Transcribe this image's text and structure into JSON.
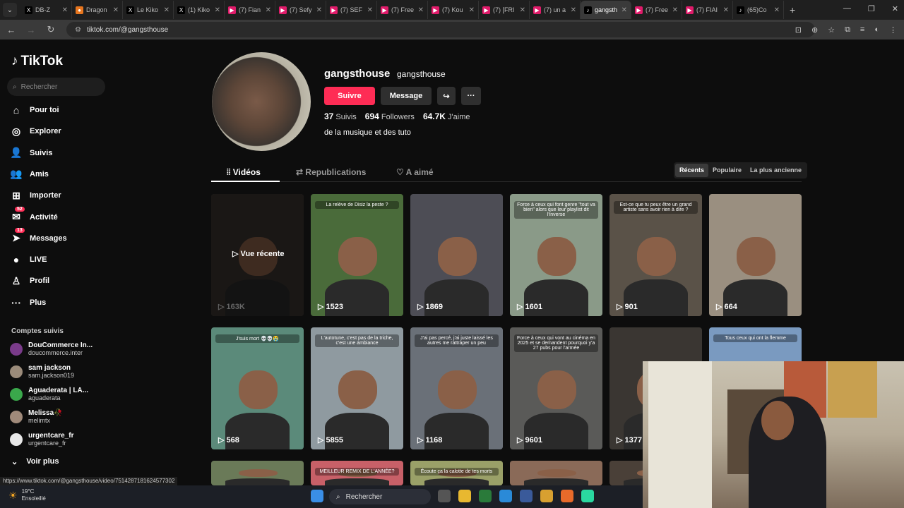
{
  "tabs": [
    {
      "label": "DB-Z",
      "color": "#000",
      "glyph": "X"
    },
    {
      "label": "Dragon",
      "color": "#e8761e",
      "glyph": "●"
    },
    {
      "label": "Le Kiko",
      "color": "#000",
      "glyph": "X"
    },
    {
      "label": "(1) Kiko",
      "color": "#000",
      "glyph": "X"
    },
    {
      "label": "(7) Fian",
      "color": "#e01b6a",
      "glyph": "▶"
    },
    {
      "label": "(7) Sefy",
      "color": "#e01b6a",
      "glyph": "▶"
    },
    {
      "label": "(7) SEF",
      "color": "#e01b6a",
      "glyph": "▶"
    },
    {
      "label": "(7) Free",
      "color": "#e01b6a",
      "glyph": "▶"
    },
    {
      "label": "(7) Kou",
      "color": "#e01b6a",
      "glyph": "▶"
    },
    {
      "label": "(7) [FRI",
      "color": "#e01b6a",
      "glyph": "▶"
    },
    {
      "label": "(7) un a",
      "color": "#e01b6a",
      "glyph": "▶"
    },
    {
      "label": "gangsth",
      "color": "#000",
      "glyph": "♪",
      "active": true
    },
    {
      "label": "(7) Free",
      "color": "#e01b6a",
      "glyph": "▶"
    },
    {
      "label": "(7) FIAI",
      "color": "#e01b6a",
      "glyph": "▶"
    },
    {
      "label": "(65)Co",
      "color": "#000",
      "glyph": "♪"
    }
  ],
  "address": {
    "url": "tiktok.com/@gangsthouse"
  },
  "sidebar": {
    "logo": "TikTok",
    "search_placeholder": "Rechercher",
    "items": [
      {
        "label": "Pour toi",
        "icon": "⌂"
      },
      {
        "label": "Explorer",
        "icon": "◎"
      },
      {
        "label": "Suivis",
        "icon": "👤"
      },
      {
        "label": "Amis",
        "icon": "👥"
      },
      {
        "label": "Importer",
        "icon": "⊞"
      },
      {
        "label": "Activité",
        "icon": "✉",
        "badge": "52"
      },
      {
        "label": "Messages",
        "icon": "➤",
        "badge": "13"
      },
      {
        "label": "LIVE",
        "icon": "●"
      },
      {
        "label": "Profil",
        "icon": "♙"
      },
      {
        "label": "Plus",
        "icon": "···"
      }
    ],
    "followed_title": "Comptes suivis",
    "followed": [
      {
        "name": "DouCommerce In...",
        "handle": "doucommerce.inter",
        "color": "#7a3b8a"
      },
      {
        "name": "sam jackson",
        "handle": "sam.jackson019",
        "color": "#9b8b7a"
      },
      {
        "name": "Aguaderata | LA...",
        "handle": "aguaderata",
        "color": "#3aa84b"
      },
      {
        "name": "Melissa🥀",
        "handle": "melimtx",
        "color": "#a08a7a"
      },
      {
        "name": "urgentcare_fr",
        "handle": "urgentcare_fr",
        "color": "#e8e8e8"
      }
    ],
    "more_label": "Voir plus"
  },
  "profile": {
    "username": "gangsthouse",
    "display": "gangsthouse",
    "follow_label": "Suivre",
    "message_label": "Message",
    "following_count": "37",
    "following_label": "Suivis",
    "followers_count": "694",
    "followers_label": "Followers",
    "likes_count": "64.7K",
    "likes_label": "J'aime",
    "bio": "de la musique et des tuto"
  },
  "tabs_profile": {
    "videos": "Vidéos",
    "reposts": "Republications",
    "liked": "A aimé"
  },
  "sort": {
    "recent": "Récents",
    "popular": "Populaire",
    "oldest": "La plus ancienne"
  },
  "videos": [
    {
      "views": "163K",
      "caption": "",
      "color": "#3b3430",
      "recent": "Vue récente"
    },
    {
      "views": "1523",
      "caption": "La relève de Disiz la peste ?",
      "color": "#4a6b3a"
    },
    {
      "views": "1869",
      "caption": "",
      "color": "#4d4d55"
    },
    {
      "views": "1601",
      "caption": "Force à ceux qui font genre \"tout va bien\" alors que leur playlist dit l'inverse",
      "color": "#8a9a88"
    },
    {
      "views": "901",
      "caption": "Est-ce que tu peux être un grand artiste sans avoir rien à dire ?",
      "color": "#5a5248"
    },
    {
      "views": "664",
      "caption": "",
      "color": "#9a8f80"
    },
    {
      "views": "568",
      "caption": "J'suis mort 💀💀😭",
      "color": "#5b8a7a"
    },
    {
      "views": "5855",
      "caption": "L'autotune, c'est pas de la triche, c'est une ambiance",
      "color": "#8f9aa0"
    },
    {
      "views": "1168",
      "caption": "J'ai pas percé, j'ai juste laissé les autres me rattraper un peu",
      "color": "#6a7078"
    },
    {
      "views": "9601",
      "caption": "Force à ceux qui vont au cinéma en 2025 et se demandent pourquoi y'a 27 pubs pour l'armée",
      "color": "#5a5a58"
    },
    {
      "views": "1377",
      "caption": "",
      "color": "#3a3632"
    },
    {
      "views": "",
      "caption": "Tous ceux qui ont la flemme",
      "color": "#7a9ac0"
    },
    {
      "views": "",
      "caption": "",
      "color": "#6a7a58"
    },
    {
      "views": "",
      "caption": "MEILLEUR REMIX DE L'ANNÉE?",
      "color": "#c86068"
    },
    {
      "views": "",
      "caption": "Écoute ça la calotte de tes morts",
      "color": "#9aa068"
    },
    {
      "views": "",
      "caption": "",
      "color": "#8a6a58"
    },
    {
      "views": "",
      "caption": "",
      "color": "#4a4038"
    }
  ],
  "status_url": "https://www.tiktok.com/@gangsthouse/video/7514287181624577302",
  "taskbar": {
    "temp": "19°C",
    "weather": "Ensoleillé",
    "search": "Rechercher"
  }
}
